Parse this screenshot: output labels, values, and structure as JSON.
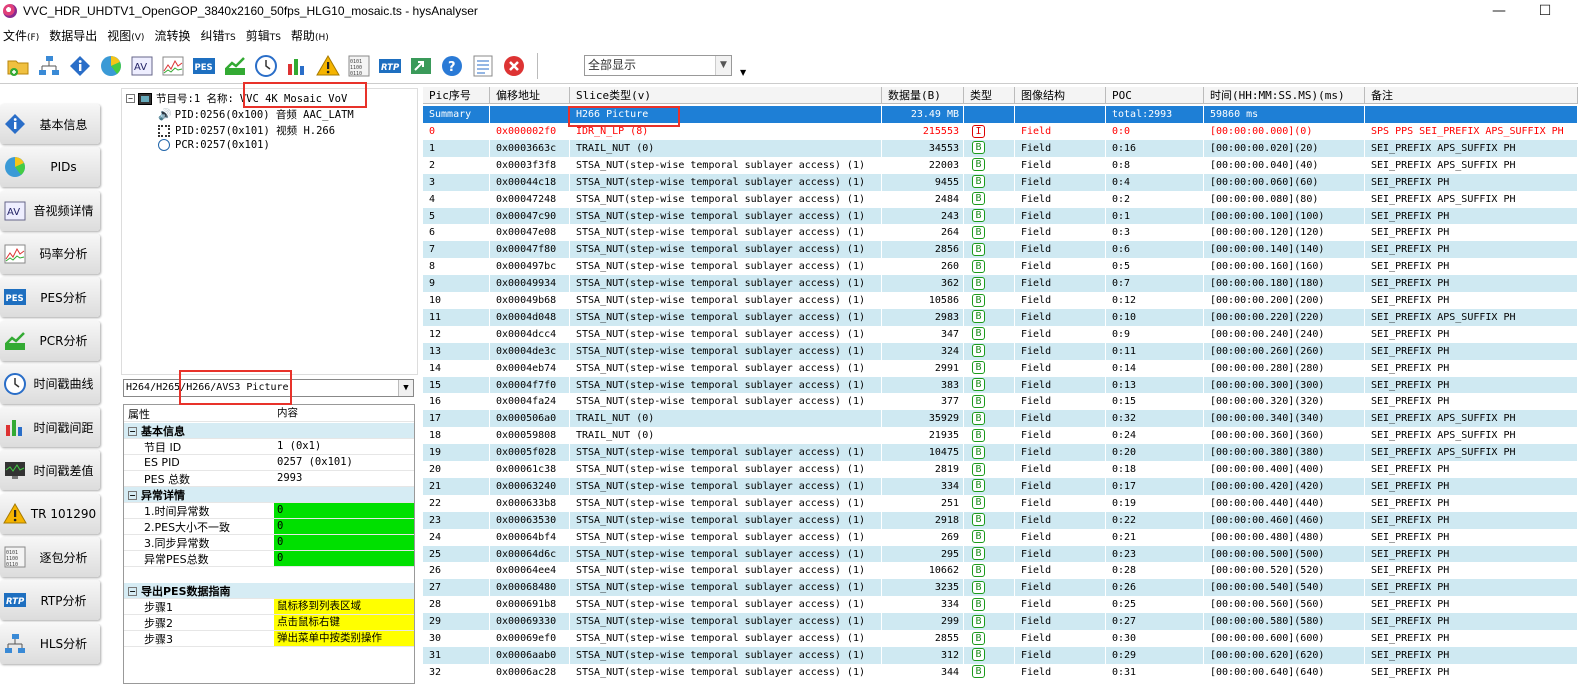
{
  "window": {
    "title": "VVC_HDR_UHDTV1_OpenGOP_3840x2160_50fps_HLG10_mosaic.ts - hysAnalyser",
    "minimize": "—",
    "maximize": "☐"
  },
  "menu": [
    {
      "label": "文件",
      "acc": "(F)"
    },
    {
      "label": "数据导出",
      "acc": ""
    },
    {
      "label": "视图",
      "acc": "(V)"
    },
    {
      "label": "流转换",
      "acc": ""
    },
    {
      "label": "纠错",
      "acc": "TS"
    },
    {
      "label": "剪辑",
      "acc": "TS"
    },
    {
      "label": "帮助",
      "acc": "(H)"
    }
  ],
  "toolbar": {
    "icons": [
      "open-folder-icon",
      "network-icon",
      "info-icon",
      "pie-chart-icon",
      "av-icon",
      "bitrate-chart-icon",
      "pes-icon",
      "pcr-chart-icon",
      "clock-icon",
      "bar-chart-icon",
      "warning-icon",
      "binary-icon",
      "rtp-icon",
      "export-icon",
      "help-icon",
      "list-icon",
      "close-icon"
    ],
    "view_select": "全部显示"
  },
  "nav": [
    {
      "label": "基本信息",
      "icon": "info-icon"
    },
    {
      "label": "PIDs",
      "icon": "pie-chart-icon"
    },
    {
      "label": "音视频详情",
      "icon": "av-icon"
    },
    {
      "label": "码率分析",
      "icon": "bitrate-chart-icon"
    },
    {
      "label": "PES分析",
      "icon": "pes-icon"
    },
    {
      "label": "PCR分析",
      "icon": "pcr-chart-icon"
    },
    {
      "label": "时间戳曲线",
      "icon": "clock-icon"
    },
    {
      "label": "时间戳间距",
      "icon": "bar-chart-icon"
    },
    {
      "label": "时间戳差值",
      "icon": "monitor-chart-icon"
    },
    {
      "label": "TR 101290",
      "icon": "warning-icon"
    },
    {
      "label": "逐包分析",
      "icon": "binary-icon"
    },
    {
      "label": "RTP分析",
      "icon": "rtp-icon"
    },
    {
      "label": "HLS分析",
      "icon": "network-icon"
    }
  ],
  "tree": {
    "program": "节目号:1 名称:",
    "program_name": "VVC 4K Mosaic VoV",
    "audio": "PID:0256(0x100) 音频 AAC_LATM",
    "video": "PID:0257(0x101) 视频 H.266",
    "pcr": "PCR:0257(0x101)"
  },
  "type_select": "H264/H265/H266/AVS3 Picture",
  "props": {
    "col_key": "属性",
    "col_val": "内容",
    "sec_basic": "基本信息",
    "basic": [
      {
        "k": "节目 ID",
        "v": "1 (0x1)"
      },
      {
        "k": "ES PID",
        "v": "0257 (0x101)"
      },
      {
        "k": "PES 总数",
        "v": "2993"
      }
    ],
    "sec_err": "异常详情",
    "errors": [
      {
        "k": "1.时间异常数",
        "v": "0"
      },
      {
        "k": "2.PES大小不一致",
        "v": "0"
      },
      {
        "k": "3.同步异常数",
        "v": "0"
      },
      {
        "k": "异常PES总数",
        "v": "0"
      }
    ],
    "sec_guide": "导出PES数据指南",
    "guide": [
      {
        "k": "步骤1",
        "v": "鼠标移到列表区域"
      },
      {
        "k": "步骤2",
        "v": "点击鼠标右键"
      },
      {
        "k": "步骤3",
        "v": "弹出菜单中按类别操作"
      }
    ]
  },
  "grid": {
    "headers": [
      "Pic序号",
      "偏移地址",
      "Slice类型(v)",
      "数据量(B)",
      "类型",
      "图像结构",
      "POC",
      "时间(HH:MM:SS.MS)(ms)",
      "备注"
    ],
    "summary": [
      "Summary",
      "",
      "H266 Picture",
      "23.49 MB",
      "",
      "",
      "total:2993",
      "59860 ms",
      ""
    ],
    "rows": [
      [
        "0",
        "0x000002f0",
        "IDR_N_LP (8)",
        "215553",
        "I",
        "Field",
        "0:0",
        "[00:00:00.000](0)",
        "SPS PPS SEI_PREFIX APS_SUFFIX PH"
      ],
      [
        "1",
        "0x0003663c",
        "TRAIL_NUT (0)",
        "34553",
        "B",
        "Field",
        "0:16",
        "[00:00:00.020](20)",
        "SEI_PREFIX APS_SUFFIX PH"
      ],
      [
        "2",
        "0x0003f3f8",
        "STSA_NUT(step-wise temporal sublayer access) (1)",
        "22003",
        "B",
        "Field",
        "0:8",
        "[00:00:00.040](40)",
        "SEI_PREFIX APS_SUFFIX PH"
      ],
      [
        "3",
        "0x00044c18",
        "STSA_NUT(step-wise temporal sublayer access) (1)",
        "9455",
        "B",
        "Field",
        "0:4",
        "[00:00:00.060](60)",
        "SEI_PREFIX PH"
      ],
      [
        "4",
        "0x00047248",
        "STSA_NUT(step-wise temporal sublayer access) (1)",
        "2484",
        "B",
        "Field",
        "0:2",
        "[00:00:00.080](80)",
        "SEI_PREFIX APS_SUFFIX PH"
      ],
      [
        "5",
        "0x00047c90",
        "STSA_NUT(step-wise temporal sublayer access) (1)",
        "243",
        "B",
        "Field",
        "0:1",
        "[00:00:00.100](100)",
        "SEI_PREFIX PH"
      ],
      [
        "6",
        "0x00047e08",
        "STSA_NUT(step-wise temporal sublayer access) (1)",
        "264",
        "B",
        "Field",
        "0:3",
        "[00:00:00.120](120)",
        "SEI_PREFIX PH"
      ],
      [
        "7",
        "0x00047f80",
        "STSA_NUT(step-wise temporal sublayer access) (1)",
        "2856",
        "B",
        "Field",
        "0:6",
        "[00:00:00.140](140)",
        "SEI_PREFIX PH"
      ],
      [
        "8",
        "0x000497bc",
        "STSA_NUT(step-wise temporal sublayer access) (1)",
        "260",
        "B",
        "Field",
        "0:5",
        "[00:00:00.160](160)",
        "SEI_PREFIX PH"
      ],
      [
        "9",
        "0x00049934",
        "STSA_NUT(step-wise temporal sublayer access) (1)",
        "362",
        "B",
        "Field",
        "0:7",
        "[00:00:00.180](180)",
        "SEI_PREFIX PH"
      ],
      [
        "10",
        "0x00049b68",
        "STSA_NUT(step-wise temporal sublayer access) (1)",
        "10586",
        "B",
        "Field",
        "0:12",
        "[00:00:00.200](200)",
        "SEI_PREFIX PH"
      ],
      [
        "11",
        "0x0004d048",
        "STSA_NUT(step-wise temporal sublayer access) (1)",
        "2983",
        "B",
        "Field",
        "0:10",
        "[00:00:00.220](220)",
        "SEI_PREFIX APS_SUFFIX PH"
      ],
      [
        "12",
        "0x0004dcc4",
        "STSA_NUT(step-wise temporal sublayer access) (1)",
        "347",
        "B",
        "Field",
        "0:9",
        "[00:00:00.240](240)",
        "SEI_PREFIX PH"
      ],
      [
        "13",
        "0x0004de3c",
        "STSA_NUT(step-wise temporal sublayer access) (1)",
        "324",
        "B",
        "Field",
        "0:11",
        "[00:00:00.260](260)",
        "SEI_PREFIX PH"
      ],
      [
        "14",
        "0x0004eb74",
        "STSA_NUT(step-wise temporal sublayer access) (1)",
        "2991",
        "B",
        "Field",
        "0:14",
        "[00:00:00.280](280)",
        "SEI_PREFIX PH"
      ],
      [
        "15",
        "0x0004f7f0",
        "STSA_NUT(step-wise temporal sublayer access) (1)",
        "383",
        "B",
        "Field",
        "0:13",
        "[00:00:00.300](300)",
        "SEI_PREFIX PH"
      ],
      [
        "16",
        "0x0004fa24",
        "STSA_NUT(step-wise temporal sublayer access) (1)",
        "377",
        "B",
        "Field",
        "0:15",
        "[00:00:00.320](320)",
        "SEI_PREFIX PH"
      ],
      [
        "17",
        "0x000506a0",
        "TRAIL_NUT (0)",
        "35929",
        "B",
        "Field",
        "0:32",
        "[00:00:00.340](340)",
        "SEI_PREFIX APS_SUFFIX PH"
      ],
      [
        "18",
        "0x00059808",
        "TRAIL_NUT (0)",
        "21935",
        "B",
        "Field",
        "0:24",
        "[00:00:00.360](360)",
        "SEI_PREFIX APS_SUFFIX PH"
      ],
      [
        "19",
        "0x0005f028",
        "STSA_NUT(step-wise temporal sublayer access) (1)",
        "10475",
        "B",
        "Field",
        "0:20",
        "[00:00:00.380](380)",
        "SEI_PREFIX APS_SUFFIX PH"
      ],
      [
        "20",
        "0x00061c38",
        "STSA_NUT(step-wise temporal sublayer access) (1)",
        "2819",
        "B",
        "Field",
        "0:18",
        "[00:00:00.400](400)",
        "SEI_PREFIX PH"
      ],
      [
        "21",
        "0x00063240",
        "STSA_NUT(step-wise temporal sublayer access) (1)",
        "334",
        "B",
        "Field",
        "0:17",
        "[00:00:00.420](420)",
        "SEI_PREFIX PH"
      ],
      [
        "22",
        "0x000633b8",
        "STSA_NUT(step-wise temporal sublayer access) (1)",
        "251",
        "B",
        "Field",
        "0:19",
        "[00:00:00.440](440)",
        "SEI_PREFIX PH"
      ],
      [
        "23",
        "0x00063530",
        "STSA_NUT(step-wise temporal sublayer access) (1)",
        "2918",
        "B",
        "Field",
        "0:22",
        "[00:00:00.460](460)",
        "SEI_PREFIX PH"
      ],
      [
        "24",
        "0x00064bf4",
        "STSA_NUT(step-wise temporal sublayer access) (1)",
        "269",
        "B",
        "Field",
        "0:21",
        "[00:00:00.480](480)",
        "SEI_PREFIX PH"
      ],
      [
        "25",
        "0x00064d6c",
        "STSA_NUT(step-wise temporal sublayer access) (1)",
        "295",
        "B",
        "Field",
        "0:23",
        "[00:00:00.500](500)",
        "SEI_PREFIX PH"
      ],
      [
        "26",
        "0x00064ee4",
        "STSA_NUT(step-wise temporal sublayer access) (1)",
        "10662",
        "B",
        "Field",
        "0:28",
        "[00:00:00.520](520)",
        "SEI_PREFIX PH"
      ],
      [
        "27",
        "0x00068480",
        "STSA_NUT(step-wise temporal sublayer access) (1)",
        "3235",
        "B",
        "Field",
        "0:26",
        "[00:00:00.540](540)",
        "SEI_PREFIX PH"
      ],
      [
        "28",
        "0x000691b8",
        "STSA_NUT(step-wise temporal sublayer access) (1)",
        "334",
        "B",
        "Field",
        "0:25",
        "[00:00:00.560](560)",
        "SEI_PREFIX PH"
      ],
      [
        "29",
        "0x00069330",
        "STSA_NUT(step-wise temporal sublayer access) (1)",
        "299",
        "B",
        "Field",
        "0:27",
        "[00:00:00.580](580)",
        "SEI_PREFIX PH"
      ],
      [
        "30",
        "0x00069ef0",
        "STSA_NUT(step-wise temporal sublayer access) (1)",
        "2855",
        "B",
        "Field",
        "0:30",
        "[00:00:00.600](600)",
        "SEI_PREFIX PH"
      ],
      [
        "31",
        "0x0006aab0",
        "STSA_NUT(step-wise temporal sublayer access) (1)",
        "312",
        "B",
        "Field",
        "0:29",
        "[00:00:00.620](620)",
        "SEI_PREFIX PH"
      ],
      [
        "32",
        "0x0006ac28",
        "STSA_NUT(step-wise temporal sublayer access) (1)",
        "344",
        "B",
        "Field",
        "0:31",
        "[00:00:00.640](640)",
        "SEI_PREFIX PH"
      ]
    ]
  },
  "colors": {
    "selection": "#1e7fd6",
    "row_alt": "#cfe9f2",
    "error_ok": "#00e000",
    "guide": "#ffff00",
    "idr": "#ff0000",
    "highlight": "#e8322a"
  }
}
